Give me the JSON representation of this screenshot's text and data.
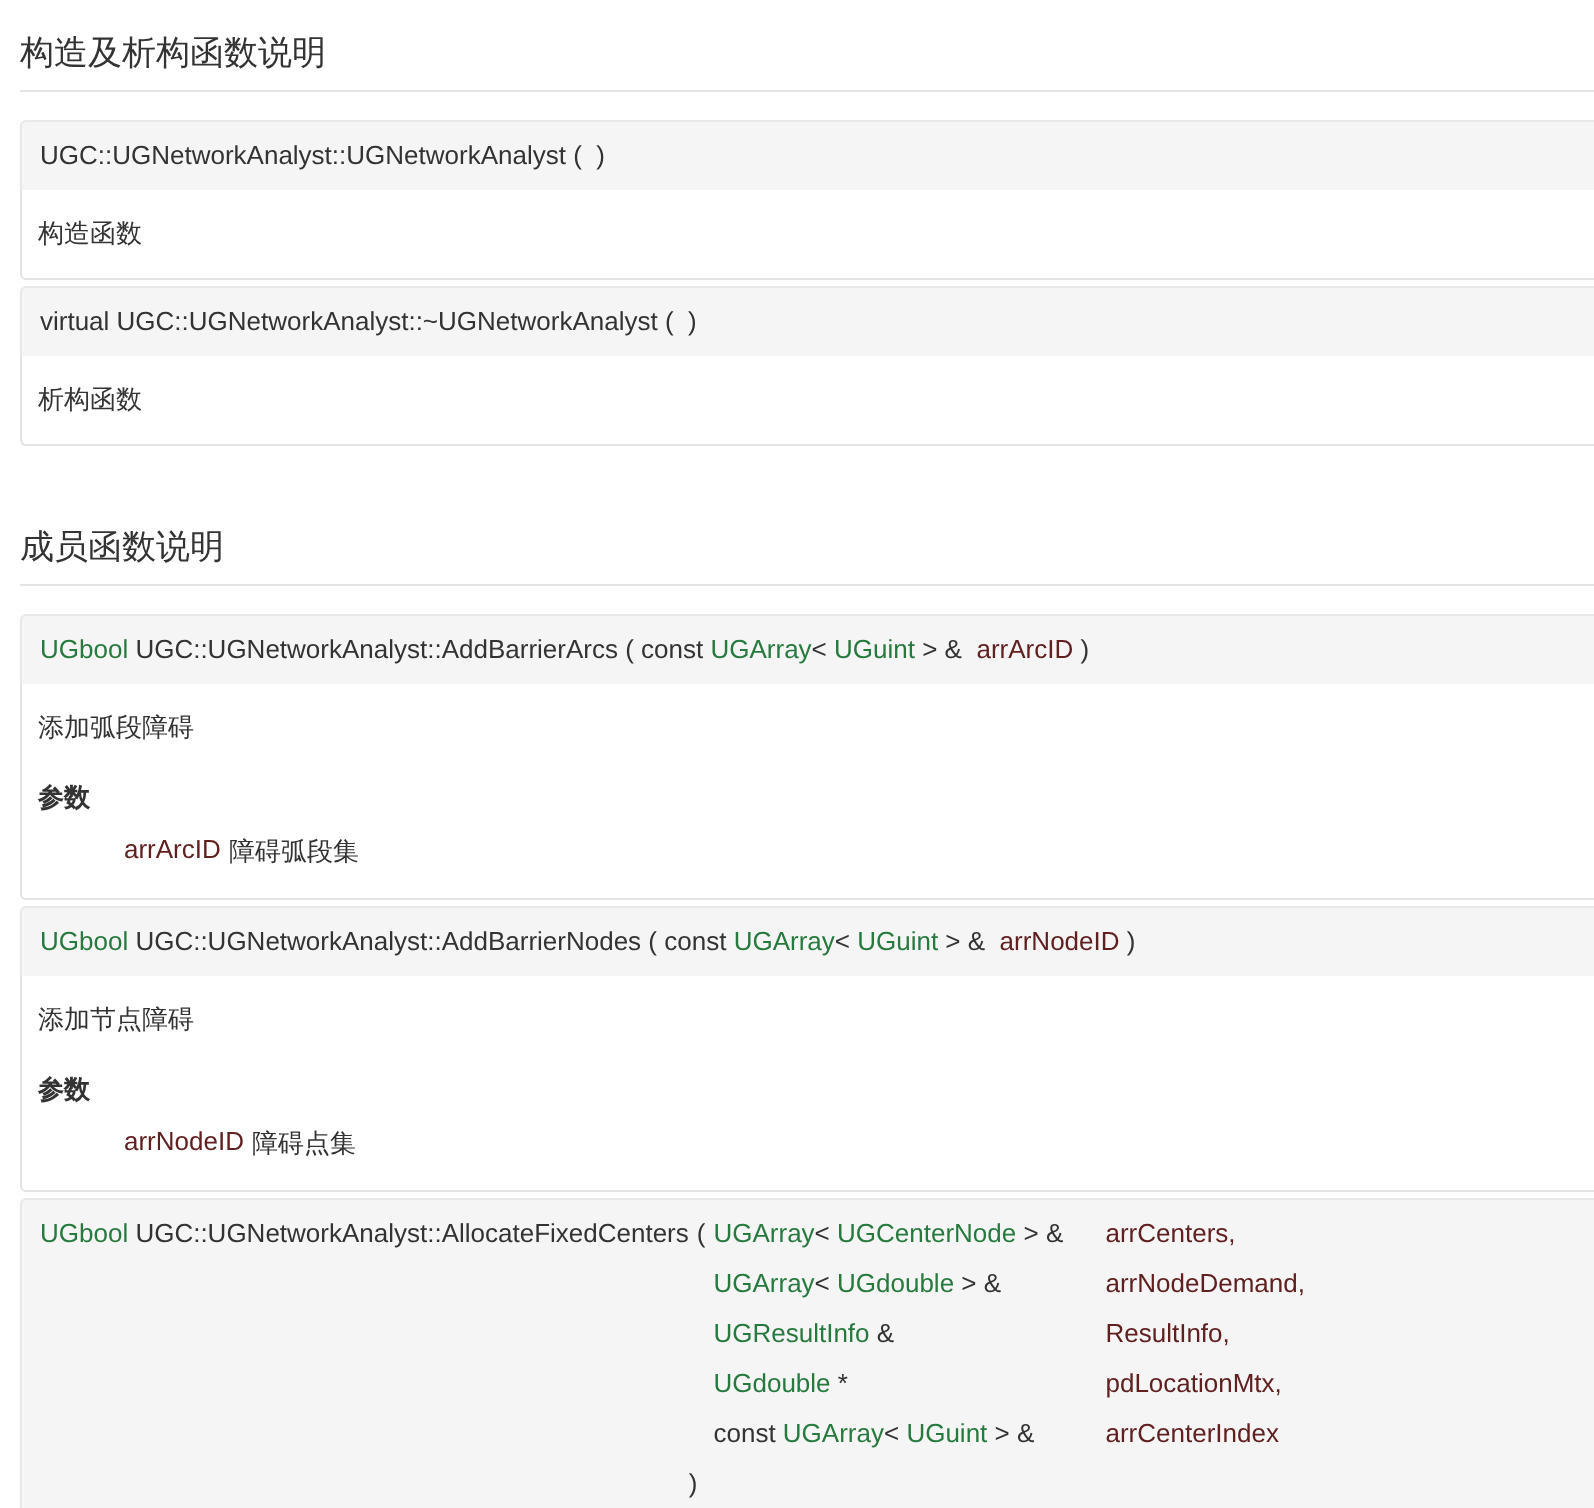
{
  "sections": [
    {
      "title": "构造及析构函数说明",
      "members": [
        {
          "name": [
            {
              "t": "UGC::UGNetworkAnalyst::UGNetworkAnalyst",
              "kind": "text"
            }
          ],
          "open": "(",
          "close": ")",
          "multiline": false,
          "brief": "构造函数"
        },
        {
          "name": [
            {
              "t": "virtual UGC::UGNetworkAnalyst::~UGNetworkAnalyst",
              "kind": "text"
            }
          ],
          "open": "(",
          "close": ")",
          "multiline": false,
          "brief": "析构函数"
        }
      ]
    },
    {
      "title": "成员函数说明",
      "members": [
        {
          "name": [
            {
              "t": "UGbool",
              "kind": "link"
            },
            {
              "t": " UGC::UGNetworkAnalyst::AddBarrierArcs",
              "kind": "text"
            }
          ],
          "open": "(",
          "params": [
            {
              "type": [
                {
                  "t": "const ",
                  "kind": "text"
                },
                {
                  "t": "UGArray",
                  "kind": "link"
                },
                {
                  "t": "< ",
                  "kind": "text"
                },
                {
                  "t": "UGuint",
                  "kind": "link"
                },
                {
                  "t": " > & ",
                  "kind": "text"
                }
              ],
              "name": "arrArcID"
            }
          ],
          "close": ")",
          "multiline": false,
          "brief": "添加弧段障碍",
          "param_label": "参数",
          "param_docs": [
            {
              "name": "arrArcID",
              "text": "障碍弧段集"
            }
          ]
        },
        {
          "name": [
            {
              "t": "UGbool",
              "kind": "link"
            },
            {
              "t": " UGC::UGNetworkAnalyst::AddBarrierNodes",
              "kind": "text"
            }
          ],
          "open": "(",
          "params": [
            {
              "type": [
                {
                  "t": "const ",
                  "kind": "text"
                },
                {
                  "t": "UGArray",
                  "kind": "link"
                },
                {
                  "t": "< ",
                  "kind": "text"
                },
                {
                  "t": "UGuint",
                  "kind": "link"
                },
                {
                  "t": " > & ",
                  "kind": "text"
                }
              ],
              "name": "arrNodeID"
            }
          ],
          "close": ")",
          "multiline": false,
          "brief": "添加节点障碍",
          "param_label": "参数",
          "param_docs": [
            {
              "name": "arrNodeID",
              "text": "障碍点集"
            }
          ]
        },
        {
          "name": [
            {
              "t": "UGbool",
              "kind": "link"
            },
            {
              "t": " UGC::UGNetworkAnalyst::AllocateFixedCenters",
              "kind": "text"
            }
          ],
          "open": "(",
          "params": [
            {
              "type": [
                {
                  "t": "UGArray",
                  "kind": "link"
                },
                {
                  "t": "< ",
                  "kind": "text"
                },
                {
                  "t": "UGCenterNode",
                  "kind": "link"
                },
                {
                  "t": " > &",
                  "kind": "text"
                }
              ],
              "name": "arrCenters,"
            },
            {
              "type": [
                {
                  "t": "UGArray",
                  "kind": "link"
                },
                {
                  "t": "< ",
                  "kind": "text"
                },
                {
                  "t": "UGdouble",
                  "kind": "link"
                },
                {
                  "t": " > &",
                  "kind": "text"
                }
              ],
              "name": "arrNodeDemand,"
            },
            {
              "type": [
                {
                  "t": "UGResultInfo",
                  "kind": "link"
                },
                {
                  "t": " &",
                  "kind": "text"
                }
              ],
              "name": "ResultInfo,"
            },
            {
              "type": [
                {
                  "t": "UGdouble",
                  "kind": "link"
                },
                {
                  "t": " *",
                  "kind": "text"
                }
              ],
              "name": "pdLocationMtx,"
            },
            {
              "type": [
                {
                  "t": "const ",
                  "kind": "text"
                },
                {
                  "t": "UGArray",
                  "kind": "link"
                },
                {
                  "t": "< ",
                  "kind": "text"
                },
                {
                  "t": "UGuint",
                  "kind": "link"
                },
                {
                  "t": " > &",
                  "kind": "text"
                }
              ],
              "name": "arrCenterIndex"
            }
          ],
          "close": ")",
          "multiline": true
        }
      ]
    }
  ]
}
